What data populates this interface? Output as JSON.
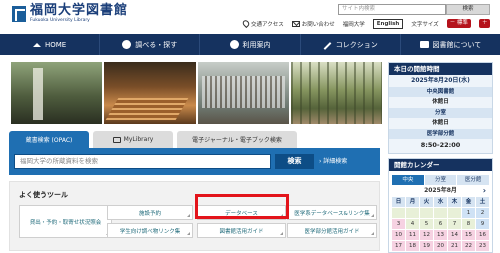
{
  "header": {
    "logo_jp": "福岡大学図書館",
    "logo_en": "Fukuoka University Library",
    "site_search_placeholder": "サイト内検索",
    "site_search_button": "検索",
    "links": {
      "access": "交通アクセス",
      "contact": "お問い合わせ",
      "univ": "福岡大学",
      "english": "English",
      "font_size_label": "文字サイズ",
      "font_minus": "－ 標準",
      "font_plus": "＋"
    }
  },
  "nav": {
    "items": [
      {
        "label": "HOME",
        "icon": "home-icon"
      },
      {
        "label": "調べる・探す",
        "icon": "search-icon"
      },
      {
        "label": "利用案内",
        "icon": "info-icon"
      },
      {
        "label": "コレクション",
        "icon": "pencil-icon"
      },
      {
        "label": "図書館について",
        "icon": "book-icon"
      }
    ]
  },
  "search": {
    "tabs": [
      "蔵書検索 (OPAC)",
      "MyLibrary",
      "電子ジャーナル・電子ブック検索"
    ],
    "placeholder": "福岡大学の所蔵資料を検索",
    "button": "検索",
    "advanced": "› 詳細検索"
  },
  "tools": {
    "title": "よく使うツール",
    "items": [
      "貸出・予約・取寄せ状況照会",
      "施設予約",
      "データベース",
      "医学系データベース&リンク集",
      "学生向け調べ物リンク集",
      "図書館活用ガイド",
      "医学部分館活用ガイド"
    ]
  },
  "hours": {
    "title": "本日の開館時間",
    "date": "2025年8月20日(水)",
    "rows": [
      {
        "name": "中央図書館",
        "value": "休館日"
      },
      {
        "name": "分室",
        "value": "休館日"
      },
      {
        "name": "医学部分館",
        "value": "8:50-22:00"
      }
    ]
  },
  "calendar": {
    "title": "開館カレンダー",
    "tabs": [
      "中央",
      "分室",
      "医分館"
    ],
    "month": "2025年8月",
    "next_arrow": "›",
    "weekdays": [
      "日",
      "月",
      "火",
      "水",
      "木",
      "金",
      "土"
    ],
    "row1": [
      "",
      "",
      "",
      "",
      "",
      "1",
      "2"
    ],
    "row2": [
      "3",
      "4",
      "5",
      "6",
      "7",
      "8",
      "9"
    ],
    "row3": [
      "10",
      "11",
      "12",
      "13",
      "14",
      "15",
      "16"
    ],
    "row4": [
      "17",
      "18",
      "19",
      "20",
      "21",
      "22",
      "23"
    ]
  }
}
